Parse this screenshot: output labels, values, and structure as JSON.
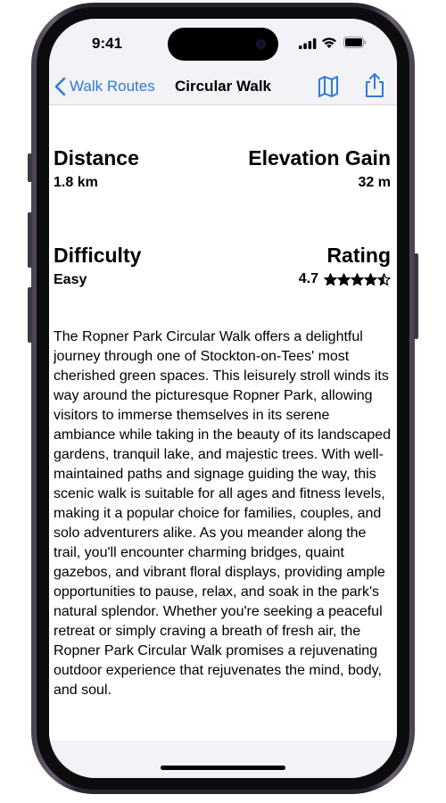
{
  "status_bar": {
    "time": "9:41",
    "icons": [
      "signal-icon",
      "wifi-icon",
      "battery-icon"
    ]
  },
  "nav": {
    "back_label": "Walk Routes",
    "title": "Circular Walk",
    "icons": [
      "chevron-left-icon",
      "map-icon",
      "share-icon"
    ]
  },
  "stats": {
    "distance": {
      "label": "Distance",
      "value": "1.8 km"
    },
    "elevation": {
      "label": "Elevation Gain",
      "value": "32 m"
    },
    "difficulty": {
      "label": "Difficulty",
      "value": "Easy"
    },
    "rating": {
      "label": "Rating",
      "value": "4.7",
      "stars": 4.5,
      "max_stars": 5
    }
  },
  "description": "The Ropner Park Circular Walk offers a delightful journey through one of Stockton-on-Tees' most cherished green spaces. This leisurely stroll winds its way around the picturesque Ropner Park, allowing visitors to immerse themselves in its serene ambiance while taking in the beauty of its landscaped gardens, tranquil lake, and majestic trees. With well-maintained paths and signage guiding the way, this scenic walk is suitable for all ages and fitness levels, making it a popular choice for families, couples, and solo adventurers alike. As you meander along the trail, you'll encounter charming bridges, quaint gazebos, and vibrant floral displays, providing ample opportunities to pause, relax, and soak in the park's natural splendor. Whether you're seeking a peaceful retreat or simply craving a breath of fresh air, the Ropner Park Circular Walk promises a rejuvenating outdoor experience that rejuvenates the mind, body, and soul.",
  "colors": {
    "accent": "#2f7bd6",
    "background": "#f2f2f7",
    "content_background": "#ffffff",
    "text": "#000000"
  }
}
